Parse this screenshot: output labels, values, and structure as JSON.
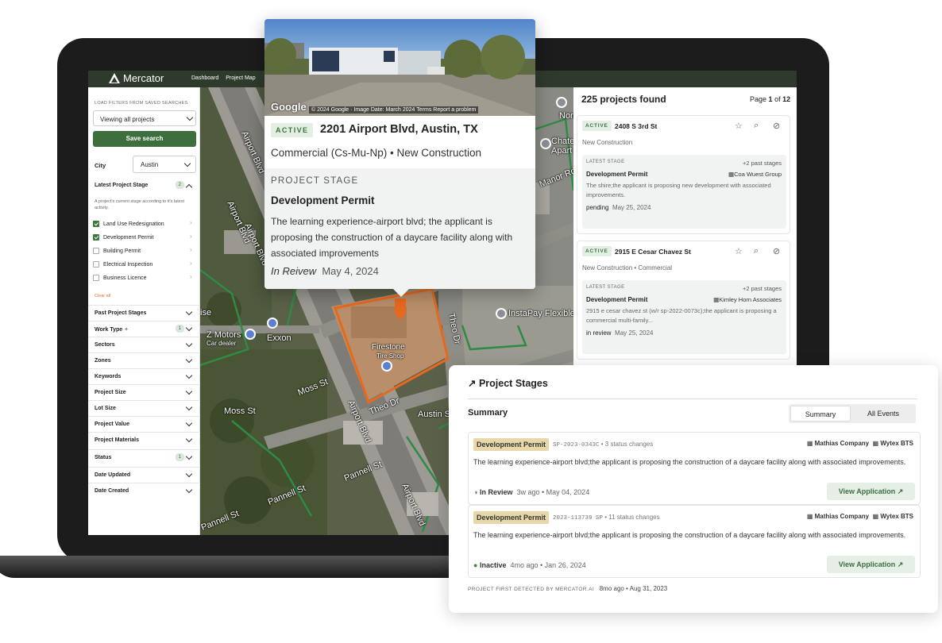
{
  "app": {
    "brand": "Mercator",
    "nav": [
      "Dashboard",
      "Project Map"
    ]
  },
  "sidebar": {
    "saved_label": "LOAD FILTERS FROM SAVED SEARCHES",
    "saved_value": "Viewing all projects",
    "save_button": "Save search",
    "city_label": "City",
    "city_value": "Austin",
    "stage_heading": "Latest Project Stage",
    "stage_count": "2",
    "stage_note": "A project's current stage according to it's latest activity.",
    "stage_options": [
      {
        "label": "Land Use Redesignation",
        "checked": true
      },
      {
        "label": "Development Permit",
        "checked": true
      },
      {
        "label": "Building Permit",
        "checked": false
      },
      {
        "label": "Electrical Inspection",
        "checked": false
      },
      {
        "label": "Business Licence",
        "checked": false
      }
    ],
    "clear_all": "Clear all",
    "filters": [
      {
        "label": "Past Project Stages",
        "badge": ""
      },
      {
        "label": "Work Type",
        "badge": "1"
      },
      {
        "label": "Sectors",
        "badge": ""
      },
      {
        "label": "Zones",
        "badge": ""
      },
      {
        "label": "Keywords",
        "badge": ""
      },
      {
        "label": "Project Size",
        "badge": ""
      },
      {
        "label": "Lot Size",
        "badge": ""
      },
      {
        "label": "Project Value",
        "badge": ""
      },
      {
        "label": "Project Materials",
        "badge": ""
      },
      {
        "label": "Status",
        "badge": "1"
      },
      {
        "label": "Date Updated",
        "badge": ""
      },
      {
        "label": "Date Created",
        "badge": ""
      }
    ]
  },
  "map": {
    "labels": [
      "Airport Blvd",
      "Airport Blvd",
      "Airport Blvd",
      "Airport Blvd",
      "Airport Blvd",
      "Moss St",
      "Moss St",
      "Theo Dr",
      "Theo Dr",
      "Pannell St",
      "Pannell St",
      "Pannell St",
      "Manor Rd",
      "Firestone",
      "Tire Shop",
      "Exxon",
      "Z Motors",
      "Car dealer",
      "ise",
      "InstaPay Flexible",
      "Austin S",
      "Chate",
      "Apart",
      "Norris"
    ]
  },
  "popover": {
    "google": "Google",
    "attribution": "© 2024 Google · Image Date: March 2024   Terms   Report a problem",
    "status": "ACTIVE",
    "address": "2201 Airport Blvd, Austin, TX",
    "type": "Commercial (Cs-Mu-Np) • New Construction",
    "stage_label": "PROJECT STAGE",
    "stage": "Development Permit",
    "description": "The learning experience-airport blvd; the applicant is proposing the construction of a daycare facility along with associated improvements",
    "review_status": "In Reivew",
    "review_date": "May 4, 2024"
  },
  "results": {
    "count": "225 projects found",
    "page_prefix": "Page",
    "page": "1",
    "page_of": "of",
    "page_total": "12",
    "cards": [
      {
        "status": "ACTIVE",
        "address": "2408 S 3rd St",
        "type": "New Construction",
        "stage_label": "LATEST STAGE",
        "past": "+2 past stages",
        "stage": "Development Permit",
        "org": "Coa Wuest Group",
        "desc": "The shire;the applicant is proposing new development with associated improvements.",
        "state": "pending",
        "date": "May 25, 2024"
      },
      {
        "status": "ACTIVE",
        "address": "2915 E Cesar Chavez St",
        "type": "New Construction • Commercial",
        "stage_label": "LATEST STAGE",
        "past": "+2 past stages",
        "stage": "Development Permit",
        "org": "Kimley Horn Associates",
        "desc": "2915 e cesar chavez st (w/r sp-2022-0073c);the applicant is proposing a commercial multi-family...",
        "state": "in review",
        "date": "May 25, 2024"
      }
    ]
  },
  "stages_panel": {
    "title": "Project Stages",
    "summary": "Summary",
    "tabs": [
      "Summary",
      "All Events"
    ],
    "items": [
      {
        "badge": "Development Permit",
        "code": "SP-2023-0343C",
        "changes": "• 3 status changes",
        "org1": "Mathias Company",
        "org2": "Wytex BTS",
        "desc": "The learning experience-airport blvd;the applicant is proposing the construction of a daycare facility along with associated improvements.",
        "status": "In Review",
        "when": "3w ago • May 04, 2024",
        "button": "View Application"
      },
      {
        "badge": "Development Permit",
        "code": "2023-113739 SP",
        "changes": "• 11 status changes",
        "org1": "Mathias Company",
        "org2": "Wytex BTS",
        "desc": "The learning experience-airport blvd;the applicant is proposing the construction of a daycare facility along with associated improvements.",
        "status": "Inactive",
        "when": "4mo ago • Jan 26, 2024",
        "button": "View Application"
      }
    ],
    "footer_label": "PROJECT FIRST DETECTED BY MERCATOR.AI",
    "footer_value": "8mo ago • Aug 31, 2023"
  },
  "colors": {
    "brand_green": "#3d6f3e",
    "nav_bg": "#2e3b2c",
    "badge_tan": "#e8d7a8",
    "highlight_orange": "#e8691e"
  }
}
